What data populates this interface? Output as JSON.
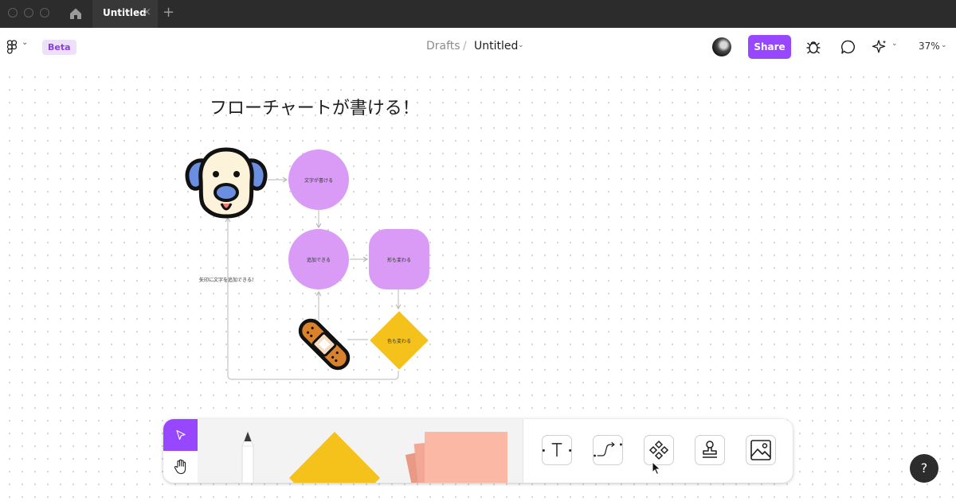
{
  "window": {
    "tab_title": "Untitled",
    "tab_close": "×",
    "new_tab": "+"
  },
  "toolbar": {
    "logo_icon": "figma-logo-icon",
    "logo_chevron": "⌄",
    "badge": "Beta",
    "breadcrumb": {
      "parent": "Drafts",
      "separator": "/",
      "file": "Untitled",
      "chevron": "⌄"
    },
    "share_label": "Share",
    "icons": [
      "bug-icon",
      "comment-icon",
      "ai-sparkle-icon"
    ],
    "ai_chevron": "⌄",
    "zoom": "37%",
    "zoom_chevron": "⌄"
  },
  "canvas": {
    "title": "フローチャートが書ける！",
    "nodes": [
      {
        "shape": "circle",
        "label": "文字が書ける",
        "color": "#d99bf5"
      },
      {
        "shape": "circle",
        "label": "追加できる",
        "color": "#d99bf5"
      },
      {
        "shape": "rounded-square",
        "label": "形も変わる",
        "color": "#d99bf5"
      },
      {
        "shape": "diamond",
        "label": "色も変わる",
        "color": "#f5c21b"
      }
    ],
    "stickers": [
      "dog-sticker",
      "bandage-sticker"
    ],
    "arrow_label": "矢印に文字を追加できる！"
  },
  "dock": {
    "tools": [
      "move-tool",
      "hand-tool"
    ],
    "gallery": [
      "pencil-tool",
      "shape-tool",
      "sticky-note-tool"
    ],
    "right_tools": [
      "text-tool",
      "connector-tool",
      "component-tool",
      "stamp-tool",
      "image-tool"
    ]
  },
  "help": {
    "label": "?"
  },
  "colors": {
    "accent": "#9747ff",
    "node_purple": "#d99bf5",
    "node_yellow": "#f5c21b",
    "sticky": "#fbb8a5"
  }
}
